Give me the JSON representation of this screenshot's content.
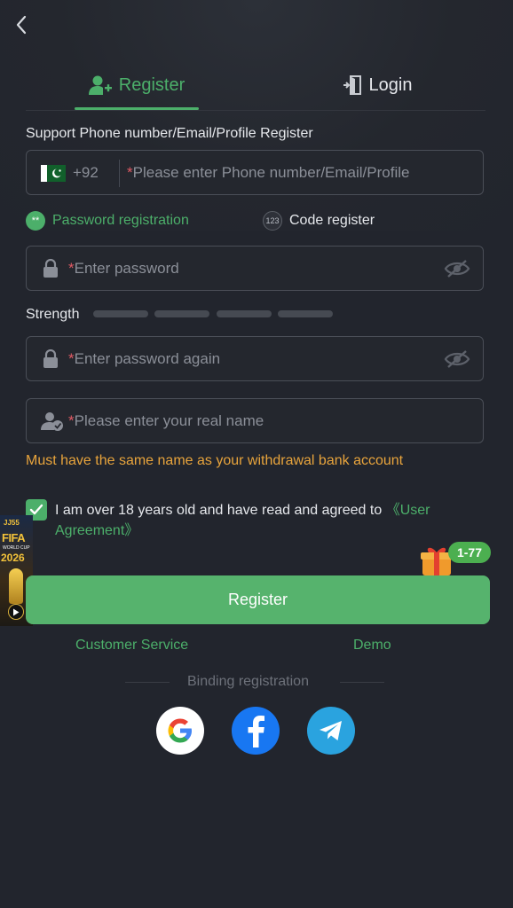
{
  "colors": {
    "accent": "#4caf6a",
    "warning": "#e8a43c",
    "background": "#22252d",
    "required_star": "#e05a64"
  },
  "nav": {
    "back_icon": "chevron-left-icon"
  },
  "tabs": [
    {
      "label": "Register",
      "icon": "user-add-icon",
      "active": true
    },
    {
      "label": "Login",
      "icon": "login-door-icon",
      "active": false
    }
  ],
  "form": {
    "section_label": "Support Phone number/Email/Profile Register",
    "country_code": "+92",
    "phone_placeholder": "Please enter Phone number/Email/Profile",
    "modes": {
      "password": "Password registration",
      "password_badge": "**",
      "code": "Code register",
      "code_badge": "123"
    },
    "password_placeholder": "Enter password",
    "strength_label": "Strength",
    "password_again_placeholder": "Enter password again",
    "real_name_placeholder": "Please enter your real name",
    "name_warning": "Must have the same name as your withdrawal bank account",
    "required_mark": "*",
    "agreement_text": "I am over 18 years old and have read and agreed to ",
    "agreement_link": "《User Agreement》",
    "agreement_checked": true,
    "register_button": "Register"
  },
  "promo": {
    "badge": "1-77",
    "banner_line1": "JJ55",
    "banner_line2": "FIFA",
    "banner_line3": "WORLD CUP",
    "banner_line4": "2026"
  },
  "links": {
    "customer_service": "Customer Service",
    "demo": "Demo"
  },
  "binding": {
    "label": "Binding registration",
    "providers": [
      "google-icon",
      "facebook-icon",
      "telegram-icon"
    ]
  }
}
